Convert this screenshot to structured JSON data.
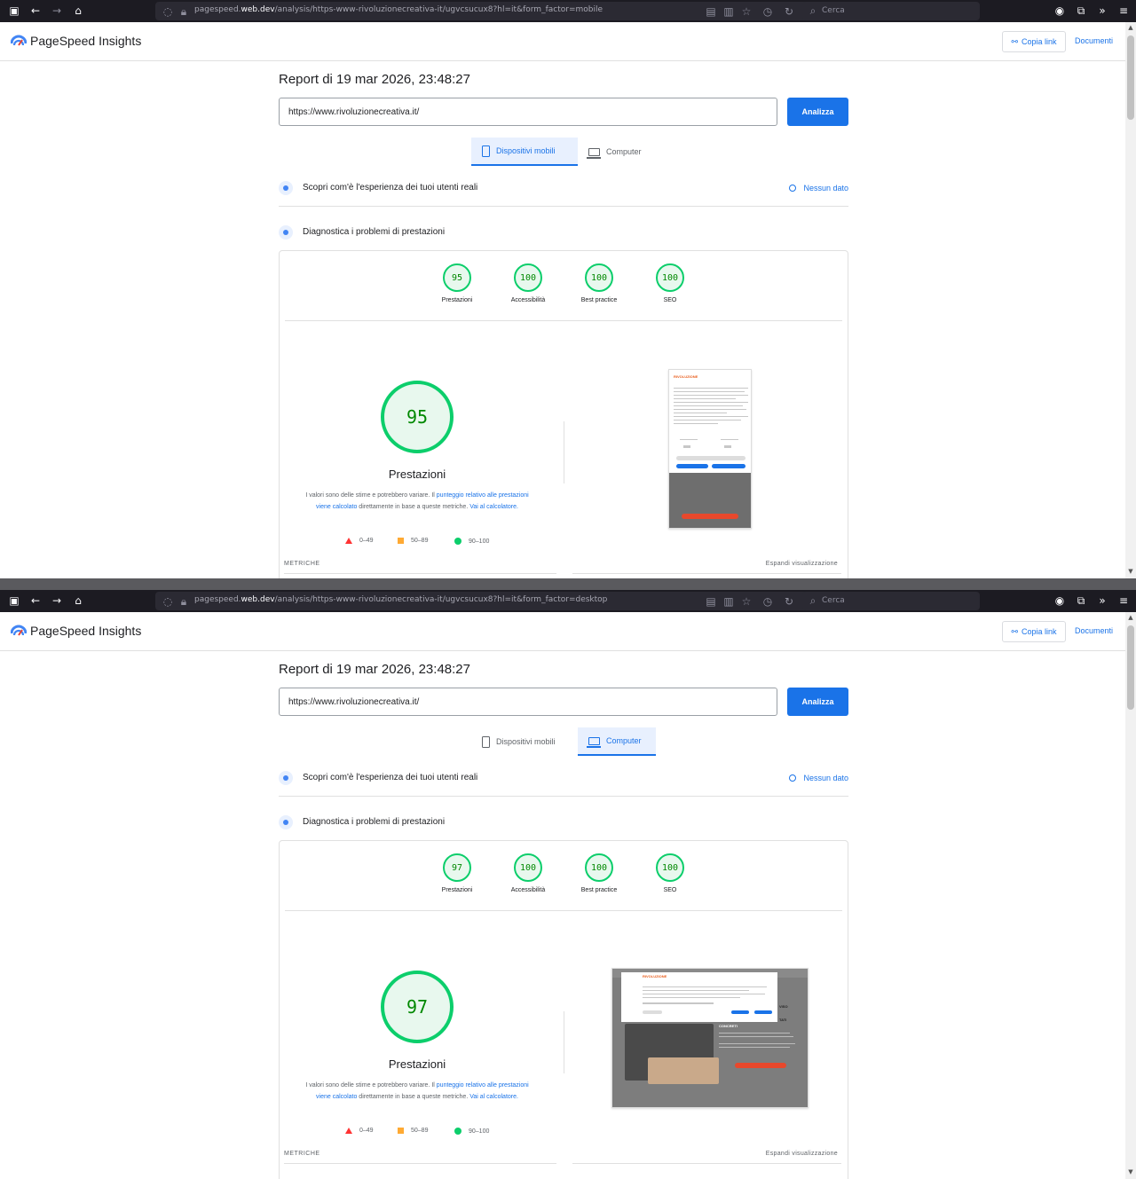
{
  "browser": {
    "shot1_url_host": "pagespeed.web.dev",
    "shot1_url_pre": "pagespeed.",
    "shot1_url_bold": "web.dev",
    "shot1_url_path": "/analysis/https-www-rivoluzionecreativa-it/ugvcsucux8?hl=it&form_factor=mobile",
    "shot2_url_path": "/analysis/https-www-rivoluzionecreativa-it/ugvcsucux8?hl=it&form_factor=desktop",
    "search_placeholder": "Cerca"
  },
  "header": {
    "title": "PageSpeed Insights",
    "copy_link": "Copia link",
    "docs": "Documenti"
  },
  "report": {
    "date": "Report di 19 mar 2026, 23:48:27",
    "url_value": "https://www.rivoluzionecreativa.it/",
    "analyze": "Analizza"
  },
  "tabs": {
    "mobile": "Dispositivi mobili",
    "desktop": "Computer"
  },
  "sections": {
    "real_users": "Scopri com'è l'esperienza dei tuoi utenti reali",
    "no_data": "Nessun dato",
    "diagnose": "Diagnostica i problemi di prestazioni"
  },
  "categories": [
    "Prestazioni",
    "Accessibilità",
    "Best practice",
    "SEO"
  ],
  "mobile_scores": [
    "95",
    "100",
    "100",
    "100"
  ],
  "desktop_scores": [
    "97",
    "100",
    "100",
    "100"
  ],
  "perf": {
    "label": "Prestazioni",
    "mobile_score": "95",
    "desktop_score": "97",
    "disclaimer_1": "I valori sono delle stime e potrebbero variare. Il ",
    "disclaimer_link1": "punteggio relativo alle prestazioni viene calcolato",
    "disclaimer_2": " direttamente in base a queste metriche. ",
    "disclaimer_link2": "Vai al calcolatore.",
    "legend": [
      "0–49",
      "50–89",
      "90–100"
    ]
  },
  "footer": {
    "metrics": "METRICHE",
    "expand": "Espandi visualizzazione"
  },
  "colors": {
    "pass": "#0cce6b",
    "average": "#ffaa33",
    "fail": "#ff3333",
    "accent": "#1a73e8"
  }
}
